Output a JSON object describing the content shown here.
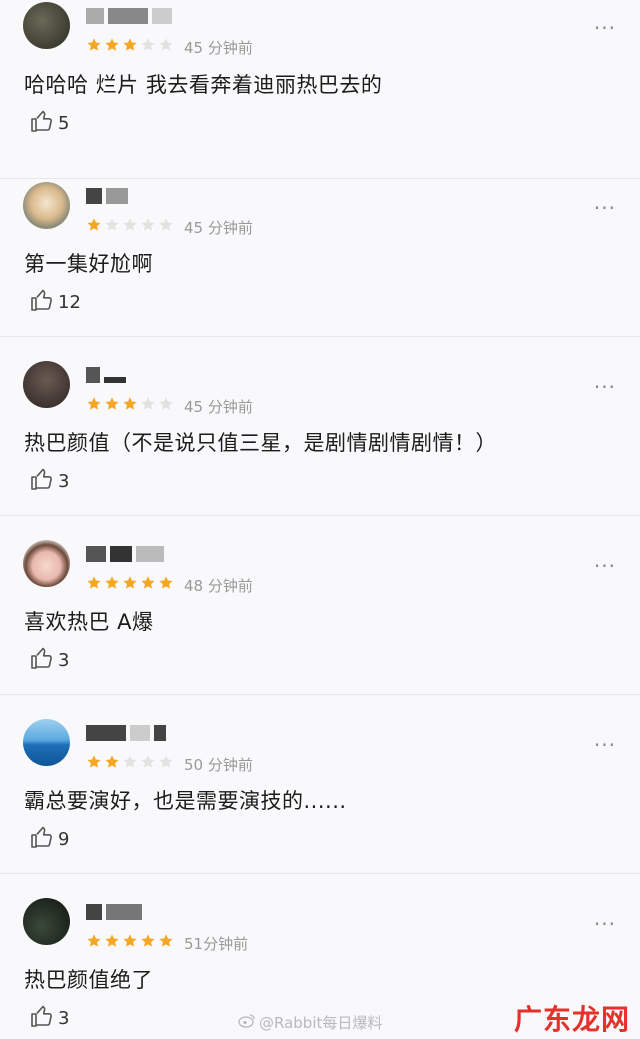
{
  "comments": [
    {
      "username": "",
      "rating": 3,
      "time": "45 分钟前",
      "text": "哈哈哈 烂片 我去看奔着迪丽热巴去的",
      "likes": "5",
      "more": "···"
    },
    {
      "username": "",
      "rating": 1,
      "time": "45 分钟前",
      "text": "第一集好尬啊",
      "likes": "12",
      "more": "···"
    },
    {
      "username": "",
      "rating": 3,
      "time": "45 分钟前",
      "text": "热巴颜值（不是说只值三星，是剧情剧情剧情！）",
      "likes": "3",
      "more": "···"
    },
    {
      "username": "",
      "rating": 5,
      "time": "48 分钟前",
      "text": "喜欢热巴 A爆",
      "likes": "3",
      "more": "···"
    },
    {
      "username": "",
      "rating": 2,
      "time": "50 分钟前",
      "text": "霸总要演好，也是需要演技的......",
      "likes": "9",
      "more": "···"
    },
    {
      "username": "",
      "rating": 5,
      "time": "51分钟前",
      "text": "热巴颜值绝了",
      "likes": "3",
      "more": "···"
    }
  ],
  "watermark": "@Rabbit每日爆料",
  "brand": "广东龙网",
  "colors": {
    "star_filled": "#f5a623",
    "star_empty": "#e2e2e2",
    "background": "#f9f8fa",
    "brand_red": "#e4312b"
  },
  "icons": {
    "like": "thumbs-up-icon",
    "more": "more-dots-icon"
  }
}
